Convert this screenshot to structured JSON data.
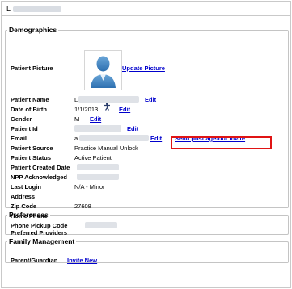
{
  "header": {
    "first_char": "L"
  },
  "demographics": {
    "legend": "Demographics",
    "patient_picture": {
      "label": "Patient Picture",
      "update_link": "Update Picture"
    },
    "patient_name": {
      "label": "Patient Name",
      "value_prefix": "L",
      "edit": "Edit"
    },
    "date_of_birth": {
      "label": "Date of Birth",
      "value": "1/1/2013",
      "edit": "Edit"
    },
    "gender": {
      "label": "Gender",
      "value": "M",
      "edit": "Edit"
    },
    "patient_id": {
      "label": "Patient Id",
      "edit": "Edit"
    },
    "email": {
      "label": "Email",
      "value_prefix": "a",
      "edit": "Edit",
      "action": "Send post age-out invite"
    },
    "patient_source": {
      "label": "Patient Source",
      "value": "Practice Manual Unlock"
    },
    "patient_status": {
      "label": "Patient Status",
      "value": "Active Patient"
    },
    "patient_created_date": {
      "label": "Patient Created Date"
    },
    "npp_acknowledged": {
      "label": "NPP Acknowledged"
    },
    "last_login": {
      "label": "Last Login",
      "value": "N/A - Minor"
    },
    "address": {
      "label": "Address"
    },
    "zip_code": {
      "label": "Zip Code",
      "value": "27608"
    },
    "home_phone": {
      "label": "Home Phone"
    },
    "phone_pickup_code": {
      "label": "Phone Pickup Code"
    }
  },
  "preferences": {
    "legend": "Preferences",
    "preferred_providers": {
      "label": "Preferred Providers"
    }
  },
  "family": {
    "legend": "Family Management",
    "parent_guardian": {
      "label": "Parent/Guardian",
      "invite": "Invite New"
    }
  },
  "colors": {
    "link": "#0000cc",
    "highlight": "#e01414",
    "border": "#c4c4c4"
  }
}
